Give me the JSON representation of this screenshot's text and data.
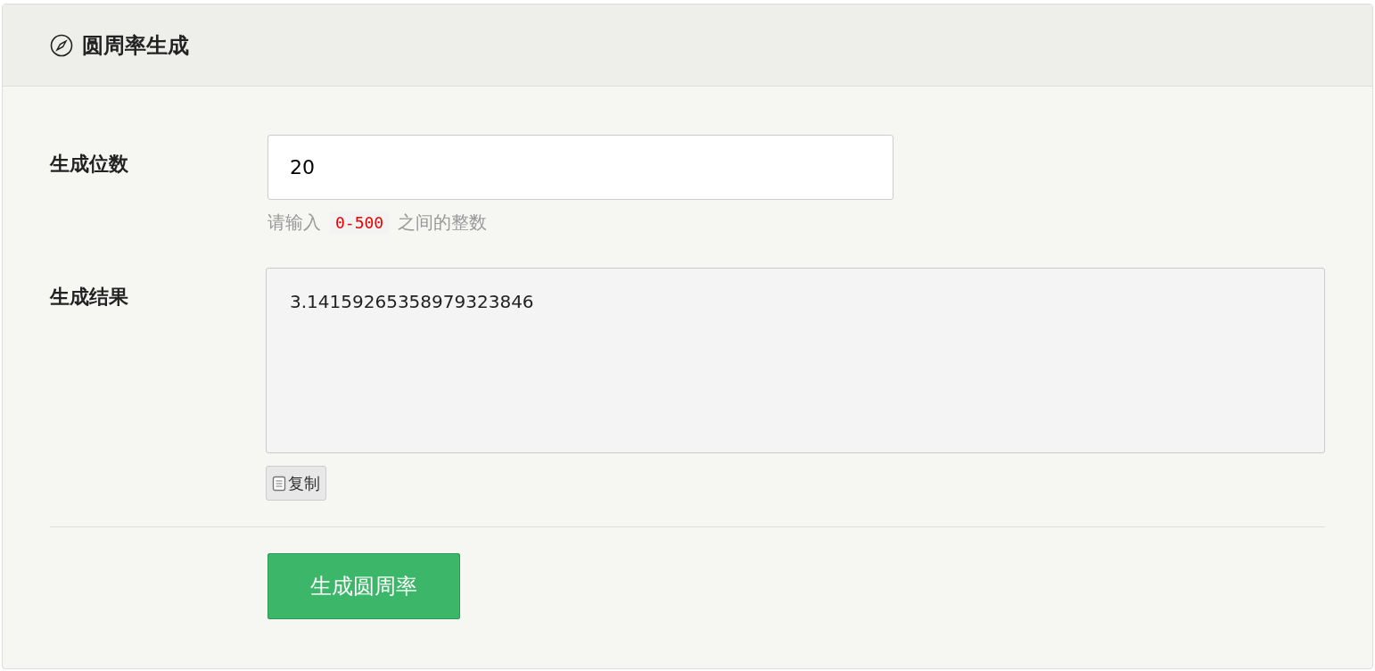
{
  "header": {
    "title": "圆周率生成"
  },
  "digits": {
    "label": "生成位数",
    "value": "20",
    "help": {
      "before": "请输入",
      "code": "0-500",
      "after": "之间的整数"
    }
  },
  "result": {
    "label": "生成结果",
    "value": "3.14159265358979323846",
    "copy_button": "复制"
  },
  "submit_button": "生成圆周率"
}
